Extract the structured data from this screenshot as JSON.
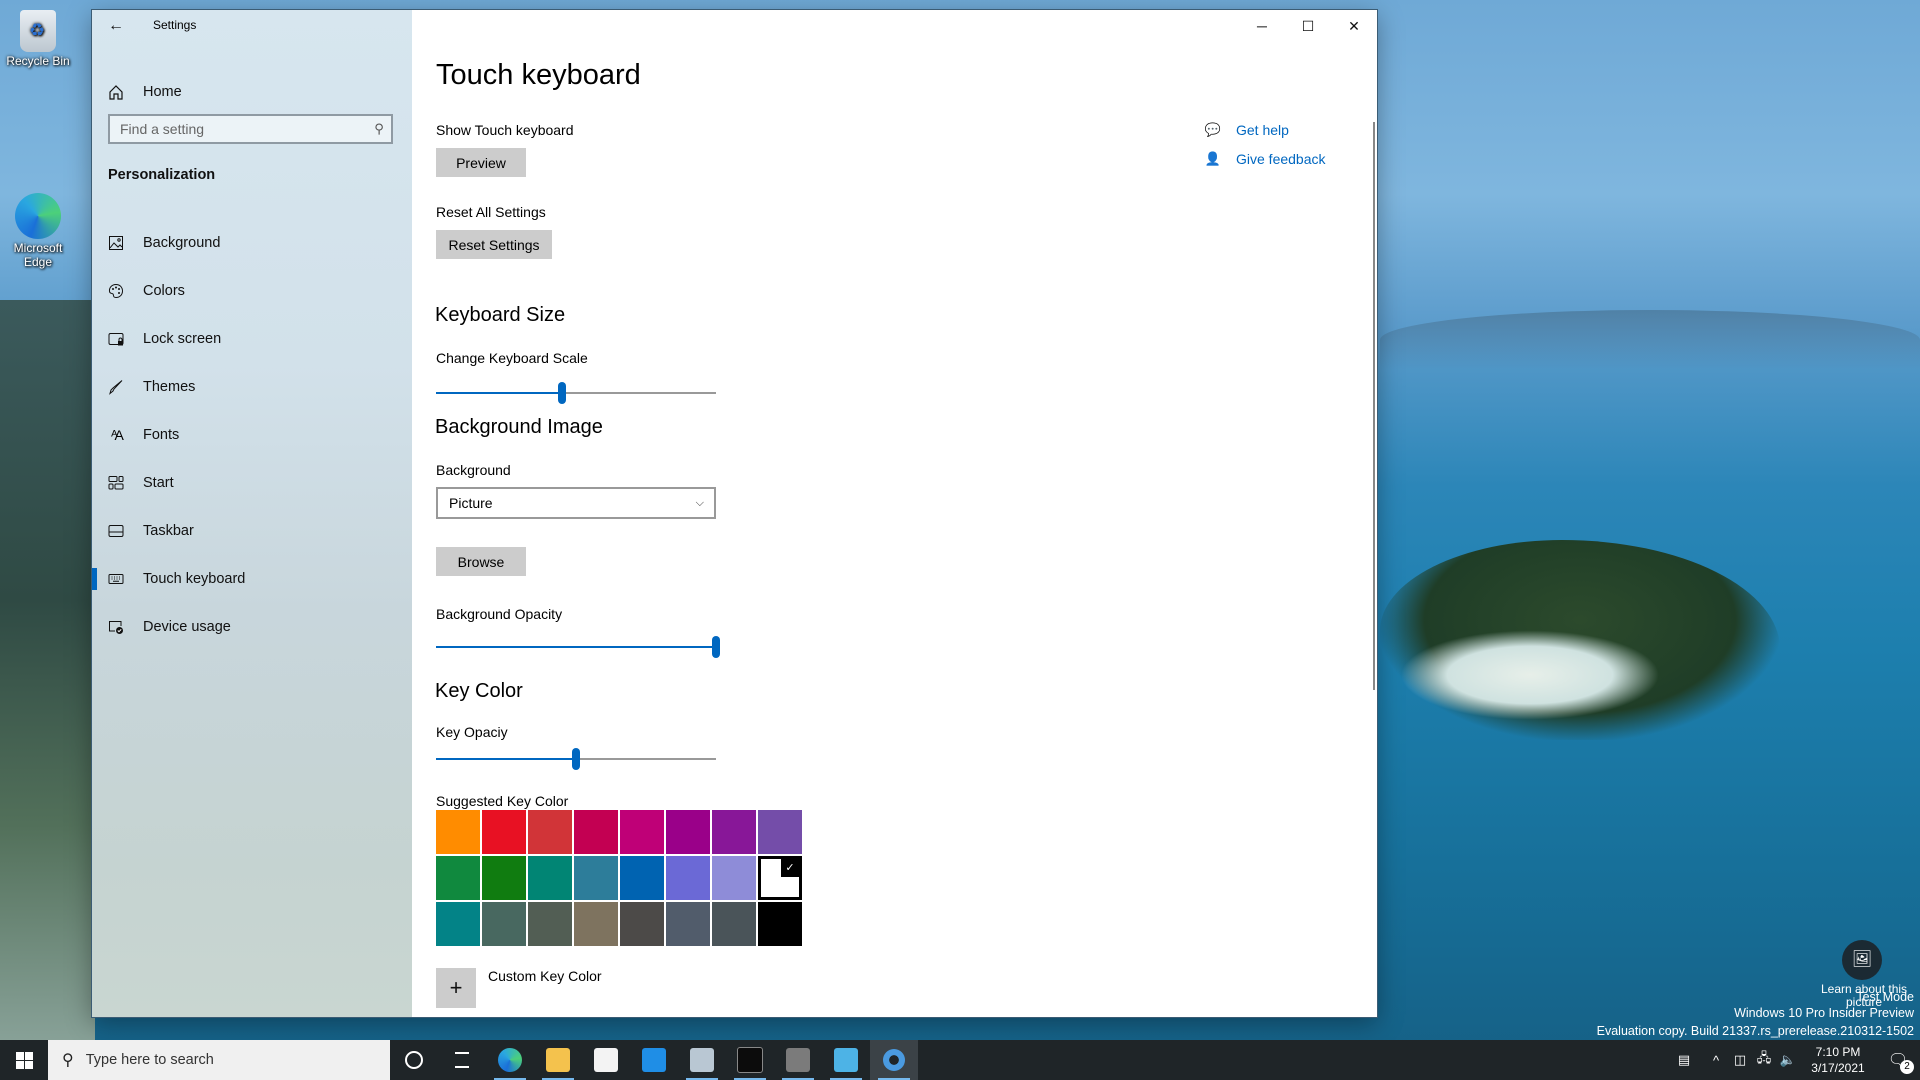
{
  "desktop": {
    "icons": [
      {
        "label": "Recycle Bin",
        "icon": "recycle-bin-icon"
      },
      {
        "label": "Microsoft Edge",
        "icon": "edge-icon"
      }
    ],
    "learn_about_picture": "Learn about this picture",
    "watermark": {
      "line1": "Test Mode",
      "line2": "Windows 10 Pro Insider Preview",
      "line3": "Evaluation copy. Build 21337.rs_prerelease.210312-1502"
    }
  },
  "window": {
    "title": "Settings",
    "controls": {
      "minimize": "─",
      "maximize": "☐",
      "close": "✕"
    }
  },
  "sidebar": {
    "home_label": "Home",
    "search_placeholder": "Find a setting",
    "section_title": "Personalization",
    "items": [
      {
        "label": "Background",
        "icon": "picture-icon",
        "selected": false
      },
      {
        "label": "Colors",
        "icon": "palette-icon",
        "selected": false
      },
      {
        "label": "Lock screen",
        "icon": "lock-screen-icon",
        "selected": false
      },
      {
        "label": "Themes",
        "icon": "brush-icon",
        "selected": false
      },
      {
        "label": "Fonts",
        "icon": "fonts-icon",
        "selected": false
      },
      {
        "label": "Start",
        "icon": "start-tiles-icon",
        "selected": false
      },
      {
        "label": "Taskbar",
        "icon": "taskbar-icon",
        "selected": false
      },
      {
        "label": "Touch keyboard",
        "icon": "keyboard-icon",
        "selected": true
      },
      {
        "label": "Device usage",
        "icon": "device-usage-icon",
        "selected": false
      }
    ]
  },
  "main": {
    "title": "Touch keyboard",
    "show_touch_keyboard": {
      "label": "Show Touch keyboard",
      "button": "Preview"
    },
    "reset": {
      "label": "Reset All Settings",
      "button": "Reset Settings"
    },
    "keyboard_size": {
      "heading": "Keyboard Size",
      "slider_label": "Change Keyboard Scale",
      "value_percent": 45
    },
    "background_image": {
      "heading": "Background Image",
      "dropdown_label": "Background",
      "dropdown_value": "Picture",
      "browse_button": "Browse",
      "opacity_label": "Background Opacity",
      "opacity_percent": 100
    },
    "key_color": {
      "heading": "Key Color",
      "opacity_label": "Key Opaciy",
      "opacity_percent": 50,
      "suggested_label": "Suggested Key Color",
      "swatches": [
        "#ff8c00",
        "#e81123",
        "#d13438",
        "#c30052",
        "#bf0077",
        "#9a0089",
        "#881798",
        "#744da9",
        "#10893e",
        "#107c10",
        "#018574",
        "#2d7d9a",
        "#0063b1",
        "#6b69d6",
        "#8e8cd8",
        "#ffffff",
        "#038387",
        "#486860",
        "#525e54",
        "#7e735f",
        "#4c4a48",
        "#515c6b",
        "#4a5459",
        "#000000"
      ],
      "selected_swatch_index": 15,
      "custom_label": "Custom Key Color",
      "custom_button": "+"
    },
    "help": {
      "get_help": "Get help",
      "give_feedback": "Give feedback"
    }
  },
  "taskbar": {
    "search_placeholder": "Type here to search",
    "apps": [
      {
        "name": "cortana",
        "color": "#ffffff",
        "running": false,
        "active": false
      },
      {
        "name": "task-view",
        "color": "#ffffff",
        "running": false,
        "active": false
      },
      {
        "name": "edge",
        "color": "#2b8fd9",
        "running": true,
        "active": false
      },
      {
        "name": "file-explorer",
        "color": "#f4c24d",
        "running": true,
        "active": false
      },
      {
        "name": "store",
        "color": "#f3f3f3",
        "running": false,
        "active": false
      },
      {
        "name": "mail",
        "color": "#1f8ee6",
        "running": false,
        "active": false
      },
      {
        "name": "resource-monitor",
        "color": "#b9c7d3",
        "running": true,
        "active": false
      },
      {
        "name": "command-prompt",
        "color": "#0c0c0c",
        "running": true,
        "active": false
      },
      {
        "name": "remote-desktop",
        "color": "#7b7b7b",
        "running": true,
        "active": false
      },
      {
        "name": "notepad",
        "color": "#4db3e6",
        "running": true,
        "active": false
      },
      {
        "name": "settings",
        "color": "#4a9ae0",
        "running": true,
        "active": true
      }
    ],
    "time": "7:10 PM",
    "date": "3/17/2021",
    "notification_count": "2"
  }
}
